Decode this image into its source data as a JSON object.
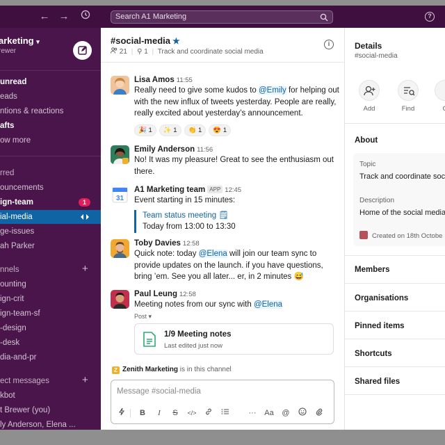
{
  "topbar": {
    "back_icon": "arrow-left-icon",
    "forward_icon": "arrow-right-icon",
    "history_icon": "clock-icon",
    "search_placeholder": "Search A1 Marketing",
    "help_label": "?"
  },
  "sidebar": {
    "workspace_name": "arketing",
    "workspace_user": "rewer",
    "items": [
      {
        "label": "unread",
        "style": "bold"
      },
      {
        "label": "eads",
        "style": "normal"
      },
      {
        "label": "ntions & reactions",
        "style": "normal"
      },
      {
        "label": "afts",
        "style": "bold"
      },
      {
        "label": "ow more",
        "style": "normal"
      }
    ],
    "starred_label": "rred",
    "starred": [
      {
        "label": "ouncements",
        "style": "normal"
      },
      {
        "label": "ign-team",
        "style": "bold",
        "badge": "1"
      },
      {
        "label": "ial-media",
        "style": "active"
      },
      {
        "label": "ge-issues",
        "style": "normal"
      },
      {
        "label": "ah Parker",
        "style": "normal"
      }
    ],
    "channels_label": "nnels",
    "channels": [
      {
        "label": "ounting"
      },
      {
        "label": "ign-crit"
      },
      {
        "label": "ign-team-sf"
      },
      {
        "label": "-design"
      },
      {
        "label": "-desk"
      },
      {
        "label": "dia-and-pr"
      }
    ],
    "dms_label": "ect messages",
    "dms": [
      {
        "label": "kbot"
      },
      {
        "label": "t Brewer (you)"
      },
      {
        "label": "ly Anderson, Elena ..."
      }
    ]
  },
  "channel": {
    "name": "#social-media",
    "star": "★",
    "members": "21",
    "pins": "1",
    "topic": "Track and coordinate social media",
    "info_label": "i",
    "messages": [
      {
        "author": "Lisa Amos",
        "time": "11:55",
        "parts": [
          "Really need to give some kudos to ",
          "@Emily",
          " for helping out with the new influx of tweets yesterday. People are really, really excited about yesterday’s announcement."
        ],
        "reactions": [
          {
            "emoji": "🎉",
            "count": "1"
          },
          {
            "emoji": "✨",
            "count": "1"
          },
          {
            "emoji": "👏",
            "count": "1"
          },
          {
            "emoji": "😍",
            "count": "1"
          }
        ]
      },
      {
        "author": "Emily Anderson",
        "time": "11:56",
        "text": "No! It was my pleasure! Great to see the enthusiasm out there."
      },
      {
        "author": "A1 Marketing team",
        "app_tag": "APP",
        "time": "12:45",
        "text": "Event starting in 15 minutes:",
        "event_title": "Team status meeting 🗒",
        "event_time": "Today from 13:00 to 13:30"
      },
      {
        "author": "Toby Davies",
        "time": "12:58",
        "parts": [
          "Quick note: today ",
          "@Elena",
          " will join our team sync to provide updates on the launch. if you have questions, bring ’em. See you all later... er, in 2 minutes 😅"
        ]
      },
      {
        "author": "Paul Leung",
        "time": "12:58",
        "parts": [
          "Meeting notes from our sync with ",
          "@Elena"
        ],
        "post_label": "Post ▾",
        "post_title": "1/9 Meeting notes",
        "post_sub": "Last edited just now"
      }
    ],
    "in_channel_badge": "Z",
    "in_channel_name": "Zenith Marketing",
    "in_channel_suffix": " is in this channel",
    "composer_placeholder": "Message #social-media",
    "toolbar_icons": [
      "lightning-icon",
      "bold-icon",
      "italic-icon",
      "strike-icon",
      "code-icon",
      "link-icon",
      "list-icon",
      "more-icon",
      "text-format-icon",
      "at-icon",
      "emoji-icon",
      "attach-icon"
    ]
  },
  "details": {
    "title": "Details",
    "subtitle": "#social-media",
    "actions": [
      {
        "label": "Add",
        "icon": "add-user-icon"
      },
      {
        "label": "Find",
        "icon": "find-icon"
      },
      {
        "label": "C",
        "icon": "call-icon"
      }
    ],
    "about_heading": "About",
    "topic_label": "Topic",
    "topic_value": "Track and coordinate soci",
    "description_label": "Description",
    "description_value": "Home of the social media",
    "created": "Created on 18th Octobe",
    "sections": [
      "Members",
      "Organisations",
      "Pinned items",
      "Shortcuts",
      "Shared files"
    ]
  },
  "colors": {
    "sidebar_bg": "#4a154b",
    "topbar_bg": "#3f0f3f",
    "active_item": "#1164a3",
    "badge": "#e01e5a",
    "link": "#1264a3"
  }
}
